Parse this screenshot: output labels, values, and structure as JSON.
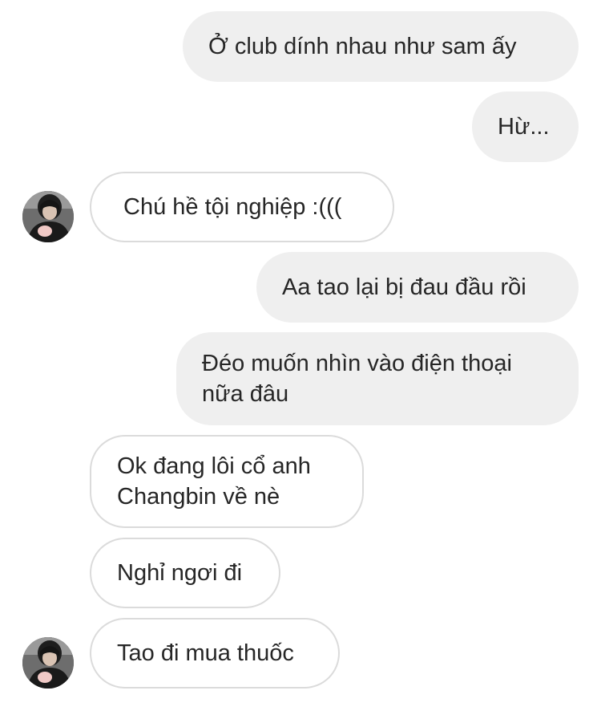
{
  "conversation": {
    "messages": [
      {
        "direction": "sent",
        "text": "Ở club dính nhau như sam ấy"
      },
      {
        "direction": "sent",
        "text": "Hừ..."
      },
      {
        "direction": "received",
        "text": "Chú hề tội nghiệp :((("
      },
      {
        "direction": "sent",
        "text": "Aa tao lại bị đau đầu rồi"
      },
      {
        "direction": "sent",
        "lines": [
          "Đéo muốn nhìn vào điện thoại",
          "nữa đâu"
        ]
      },
      {
        "direction": "received",
        "lines": [
          "Ok đang lôi cổ anh",
          "Changbin về nè"
        ]
      },
      {
        "direction": "received",
        "text": "Nghỉ ngơi đi"
      },
      {
        "direction": "received",
        "text": "Tao đi mua thuốc"
      }
    ]
  },
  "colors": {
    "sent_bubble": "#efefef",
    "received_border": "#dbdbdb",
    "text": "#262626"
  },
  "icons": {
    "avatar": "contact-avatar-photo"
  }
}
